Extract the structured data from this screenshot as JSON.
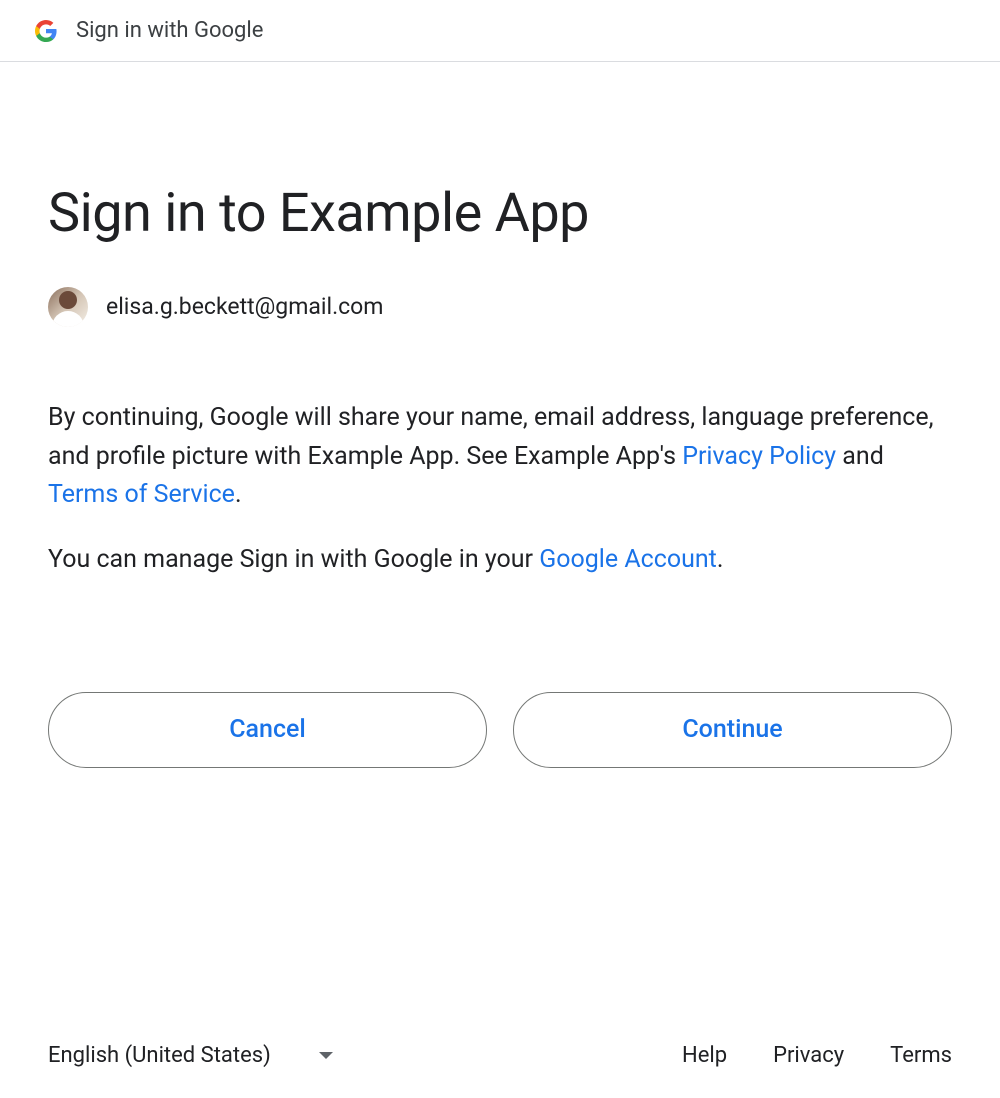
{
  "header": {
    "text": "Sign in with Google"
  },
  "main": {
    "title": "Sign in to Example App",
    "email": "elisa.g.beckett@gmail.com",
    "consent_text_1": "By continuing, Google will share your name, email address, language preference, and profile picture with Example App. See Example App's ",
    "privacy_policy_link": "Privacy Policy",
    "consent_and": " and ",
    "terms_link": "Terms of Service",
    "consent_period": ".",
    "manage_text": "You can manage Sign in with Google in your ",
    "google_account_link": "Google Account",
    "manage_period": "."
  },
  "buttons": {
    "cancel": "Cancel",
    "continue": "Continue"
  },
  "footer": {
    "language": "English (United States)",
    "help": "Help",
    "privacy": "Privacy",
    "terms": "Terms"
  }
}
